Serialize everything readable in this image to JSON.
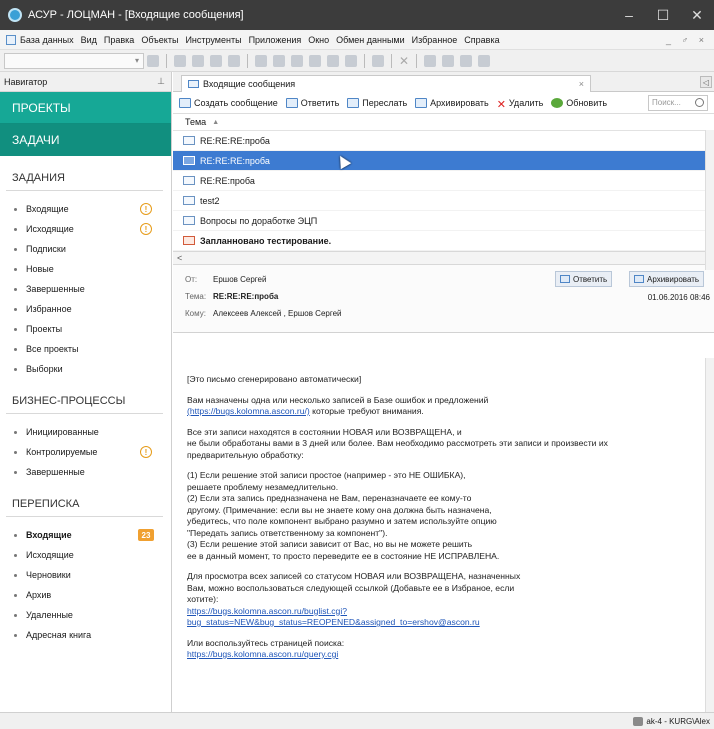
{
  "window": {
    "title": "АСУР - ЛОЦМАН - [Входящие сообщения]",
    "minimize": "–",
    "maximize": "☐",
    "close": "✕"
  },
  "menu": {
    "items": [
      "База данных",
      "Вид",
      "Правка",
      "Объекты",
      "Инструменты",
      "Приложения",
      "Окно",
      "Обмен данными",
      "Избранное",
      "Справка"
    ],
    "right": "_ ♂ ×"
  },
  "toolbar": {
    "combo_arrow": "▾"
  },
  "navigator": {
    "title": "Навигатор",
    "pin": "⊥",
    "projects": "ПРОЕКТЫ",
    "tasks": "ЗАДАЧИ",
    "sections": [
      {
        "title": "ЗАДАНИЯ",
        "items": [
          {
            "label": "Входящие",
            "badge": "!",
            "type": "warn"
          },
          {
            "label": "Исходящие",
            "badge": "!",
            "type": "warn"
          },
          {
            "label": "Подписки"
          },
          {
            "label": "Новые"
          },
          {
            "label": "Завершенные"
          },
          {
            "label": "Избранное"
          },
          {
            "label": "Проекты"
          },
          {
            "label": "Все проекты"
          },
          {
            "label": "Выборки"
          }
        ]
      },
      {
        "title": "БИЗНЕС-ПРОЦЕССЫ",
        "items": [
          {
            "label": "Инициированные"
          },
          {
            "label": "Контролируемые",
            "badge": "!",
            "type": "warn"
          },
          {
            "label": "Завершенные"
          }
        ]
      },
      {
        "title": "ПЕРЕПИСКА",
        "items": [
          {
            "label": "Входящие",
            "badge": "23",
            "type": "count",
            "bold": true
          },
          {
            "label": "Исходящие"
          },
          {
            "label": "Черновики"
          },
          {
            "label": "Архив"
          },
          {
            "label": "Удаленные"
          },
          {
            "label": "Адресная книга"
          }
        ]
      }
    ]
  },
  "tab": {
    "label": "Входящие сообщения",
    "close": "×",
    "nav": "◁"
  },
  "actions": [
    {
      "label": "Создать сообщение",
      "color": "#4f86c6"
    },
    {
      "label": "Ответить",
      "color": "#4f86c6"
    },
    {
      "label": "Переслать",
      "color": "#4f86c6"
    },
    {
      "label": "Архивировать",
      "color": "#4f86c6"
    },
    {
      "label": "Удалить",
      "color": "#d22222",
      "icon": "✕"
    },
    {
      "label": "Обновить",
      "color": "#5aa83a"
    }
  ],
  "search": {
    "placeholder": "Поиск..."
  },
  "list": {
    "column": "Тема",
    "sort": "▲",
    "rows": [
      {
        "subject": "RE:RE:RE:проба"
      },
      {
        "subject": "RE:RE:RE:проба",
        "selected": true
      },
      {
        "subject": "RE:RE:проба"
      },
      {
        "subject": "test2"
      },
      {
        "subject": "Вопросы по доработке ЭЦП"
      },
      {
        "subject": "Запланновано тестирование.",
        "bold": true,
        "flag": true
      }
    ],
    "scroll_left": "<",
    "scroll_right": ">"
  },
  "message": {
    "from_label": "От:",
    "from": "Ершов Сергей",
    "subject_label": "Тема:",
    "subject": "RE:RE:RE:проба",
    "to_label": "Кому:",
    "to": "Алексеев Алексей , Ершов Сергей",
    "reply": "Ответить",
    "archive": "Архивировать",
    "date": "01.06.2016 08:46"
  },
  "body": {
    "p1": "[Это письмо сгенерировано автоматически]",
    "p2": "Вам назначены одна или несколько записей в Базе ошибок и предложений",
    "p2_link": "(https://bugs.kolomna.ascon.ru/)",
    "p2_tail": " которые требуют внимания.",
    "p3": "Все эти записи находятся в состоянии НОВАЯ или ВОЗВРАЩЕНА, и\nне были обработаны вами в 3 дней или более. Вам необходимо рассмотреть эти записи и произвести их\nпредварительную обработку:",
    "p4": "(1) Если решение этой записи простое (например - это НЕ ОШИБКА),\n      решаете проблему незамедлительно.\n(2) Если эта запись предназначена не Вам, переназначаете ее кому-то\n      другому. (Примечание: если вы не знаете кому она должна быть назначена,\n      убедитесь, что поле компонент выбрано разумно и затем используйте опцию\n      \"Передать запись ответственному за компонент\").\n(3) Если решение этой записи зависит от Вас, но вы не можете решить\n      ее в данный момент, то просто переведите ее в состояние НЕ ИСПРАВЛЕНА.",
    "p5": "Для просмотра всех записей со статусом НОВАЯ или ВОЗВРАЩЕНА, назначенных\nВам, можно воспользоваться следующей ссылкой (Добавьте ее в Избраное, если\nхотите):",
    "link1": "https://bugs.kolomna.ascon.ru/buglist.cgi?",
    "link2": "bug_status=NEW&bug_status=REOPENED&assigned_to=ershov@ascon.ru",
    "p6": "Или воспользуйтесь страницей поиска:",
    "link3": "https://bugs.kolomna.ascon.ru/query.cgi"
  },
  "status": {
    "user": "ak-4 - KURG\\Alex"
  }
}
